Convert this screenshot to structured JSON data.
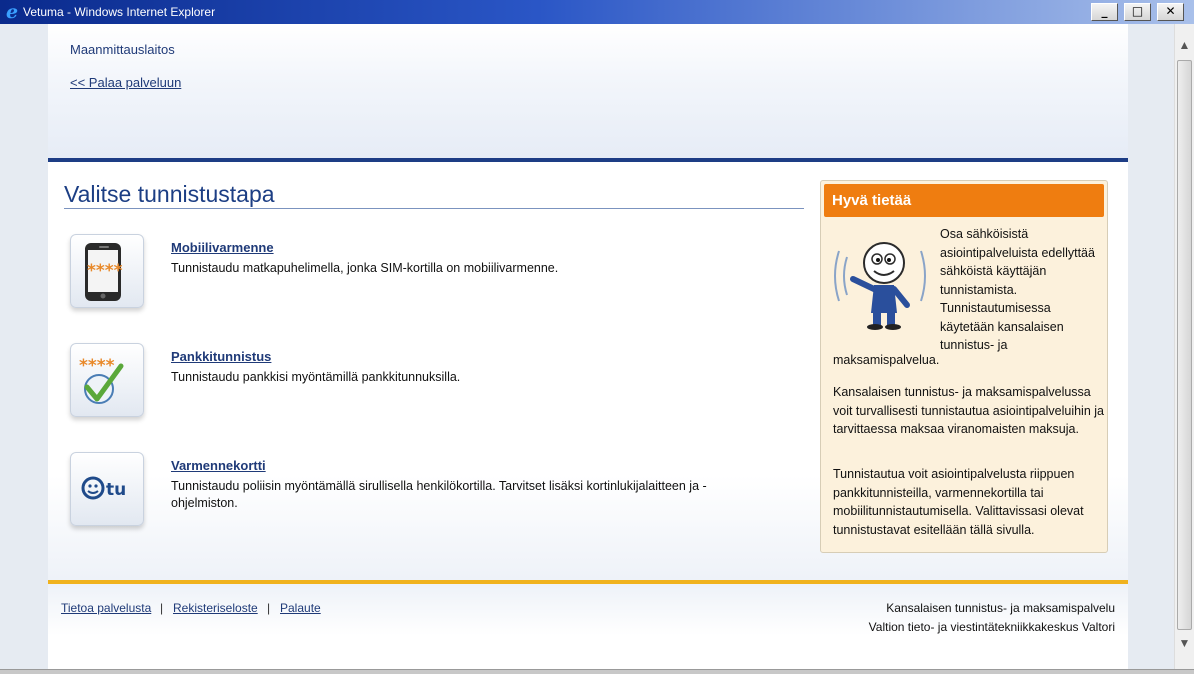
{
  "window": {
    "title": "Vetuma - Windows Internet Explorer",
    "minimize": "_",
    "maximize": "□",
    "close": "✕"
  },
  "header": {
    "organization": "Maanmittauslaitos",
    "back_link": "<< Palaa palveluun"
  },
  "main": {
    "heading": "Valitse tunnistustapa",
    "methods": [
      {
        "title": "Mobiilivarmenne",
        "description": "Tunnistaudu matkapuhelimella, jonka SIM-kortilla on mobiilivarmenne.",
        "icon": "mobile-phone-icon",
        "pin": "****"
      },
      {
        "title": "Pankkitunnistus",
        "description": "Tunnistaudu pankkisi myöntämillä pankkitunnuksilla.",
        "icon": "bank-check-icon",
        "pin": "****"
      },
      {
        "title": "Varmennekortti",
        "description": "Tunnistaudu poliisin myöntämällä sirullisella henkilökortilla. Tarvitset lisäksi kortinlukijalaitteen ja -ohjelmiston.",
        "icon": "id-card-tu-icon",
        "logo_text": "tu"
      }
    ]
  },
  "sidebar": {
    "heading": "Hyvä tietää",
    "paragraph1": "Osa sähköisistä asiointipalveluista edellyttää sähköistä käyttäjän tunnistamista. Tunnistautumisessa käytetään kansalaisen tunnistus- ja",
    "paragraph1_tail": "maksamispalvelua.",
    "paragraph2": "Kansalaisen tunnistus- ja maksamispalvelussa voit turvallisesti tunnistautua asiointipalveluihin ja tarvittaessa maksaa viranomaisten maksuja.",
    "paragraph3": "Tunnistautua voit asiointipalvelusta riippuen pankkitunnisteilla, varmennekortilla tai mobiilitunnistautumisella. Valittavissasi olevat tunnistustavat esitellään tällä sivulla."
  },
  "footer": {
    "links": [
      "Tietoa palvelusta",
      "Rekisteriseloste",
      "Palaute"
    ],
    "separator": "|",
    "right_line1": "Kansalaisen tunnistus- ja maksamispalvelu",
    "right_line2": "Valtion tieto- ja viestintätekniikkakeskus Valtori"
  },
  "colors": {
    "brand_blue": "#1d3d85",
    "accent_orange": "#ef7d10",
    "footer_rule": "#f0b21e"
  }
}
